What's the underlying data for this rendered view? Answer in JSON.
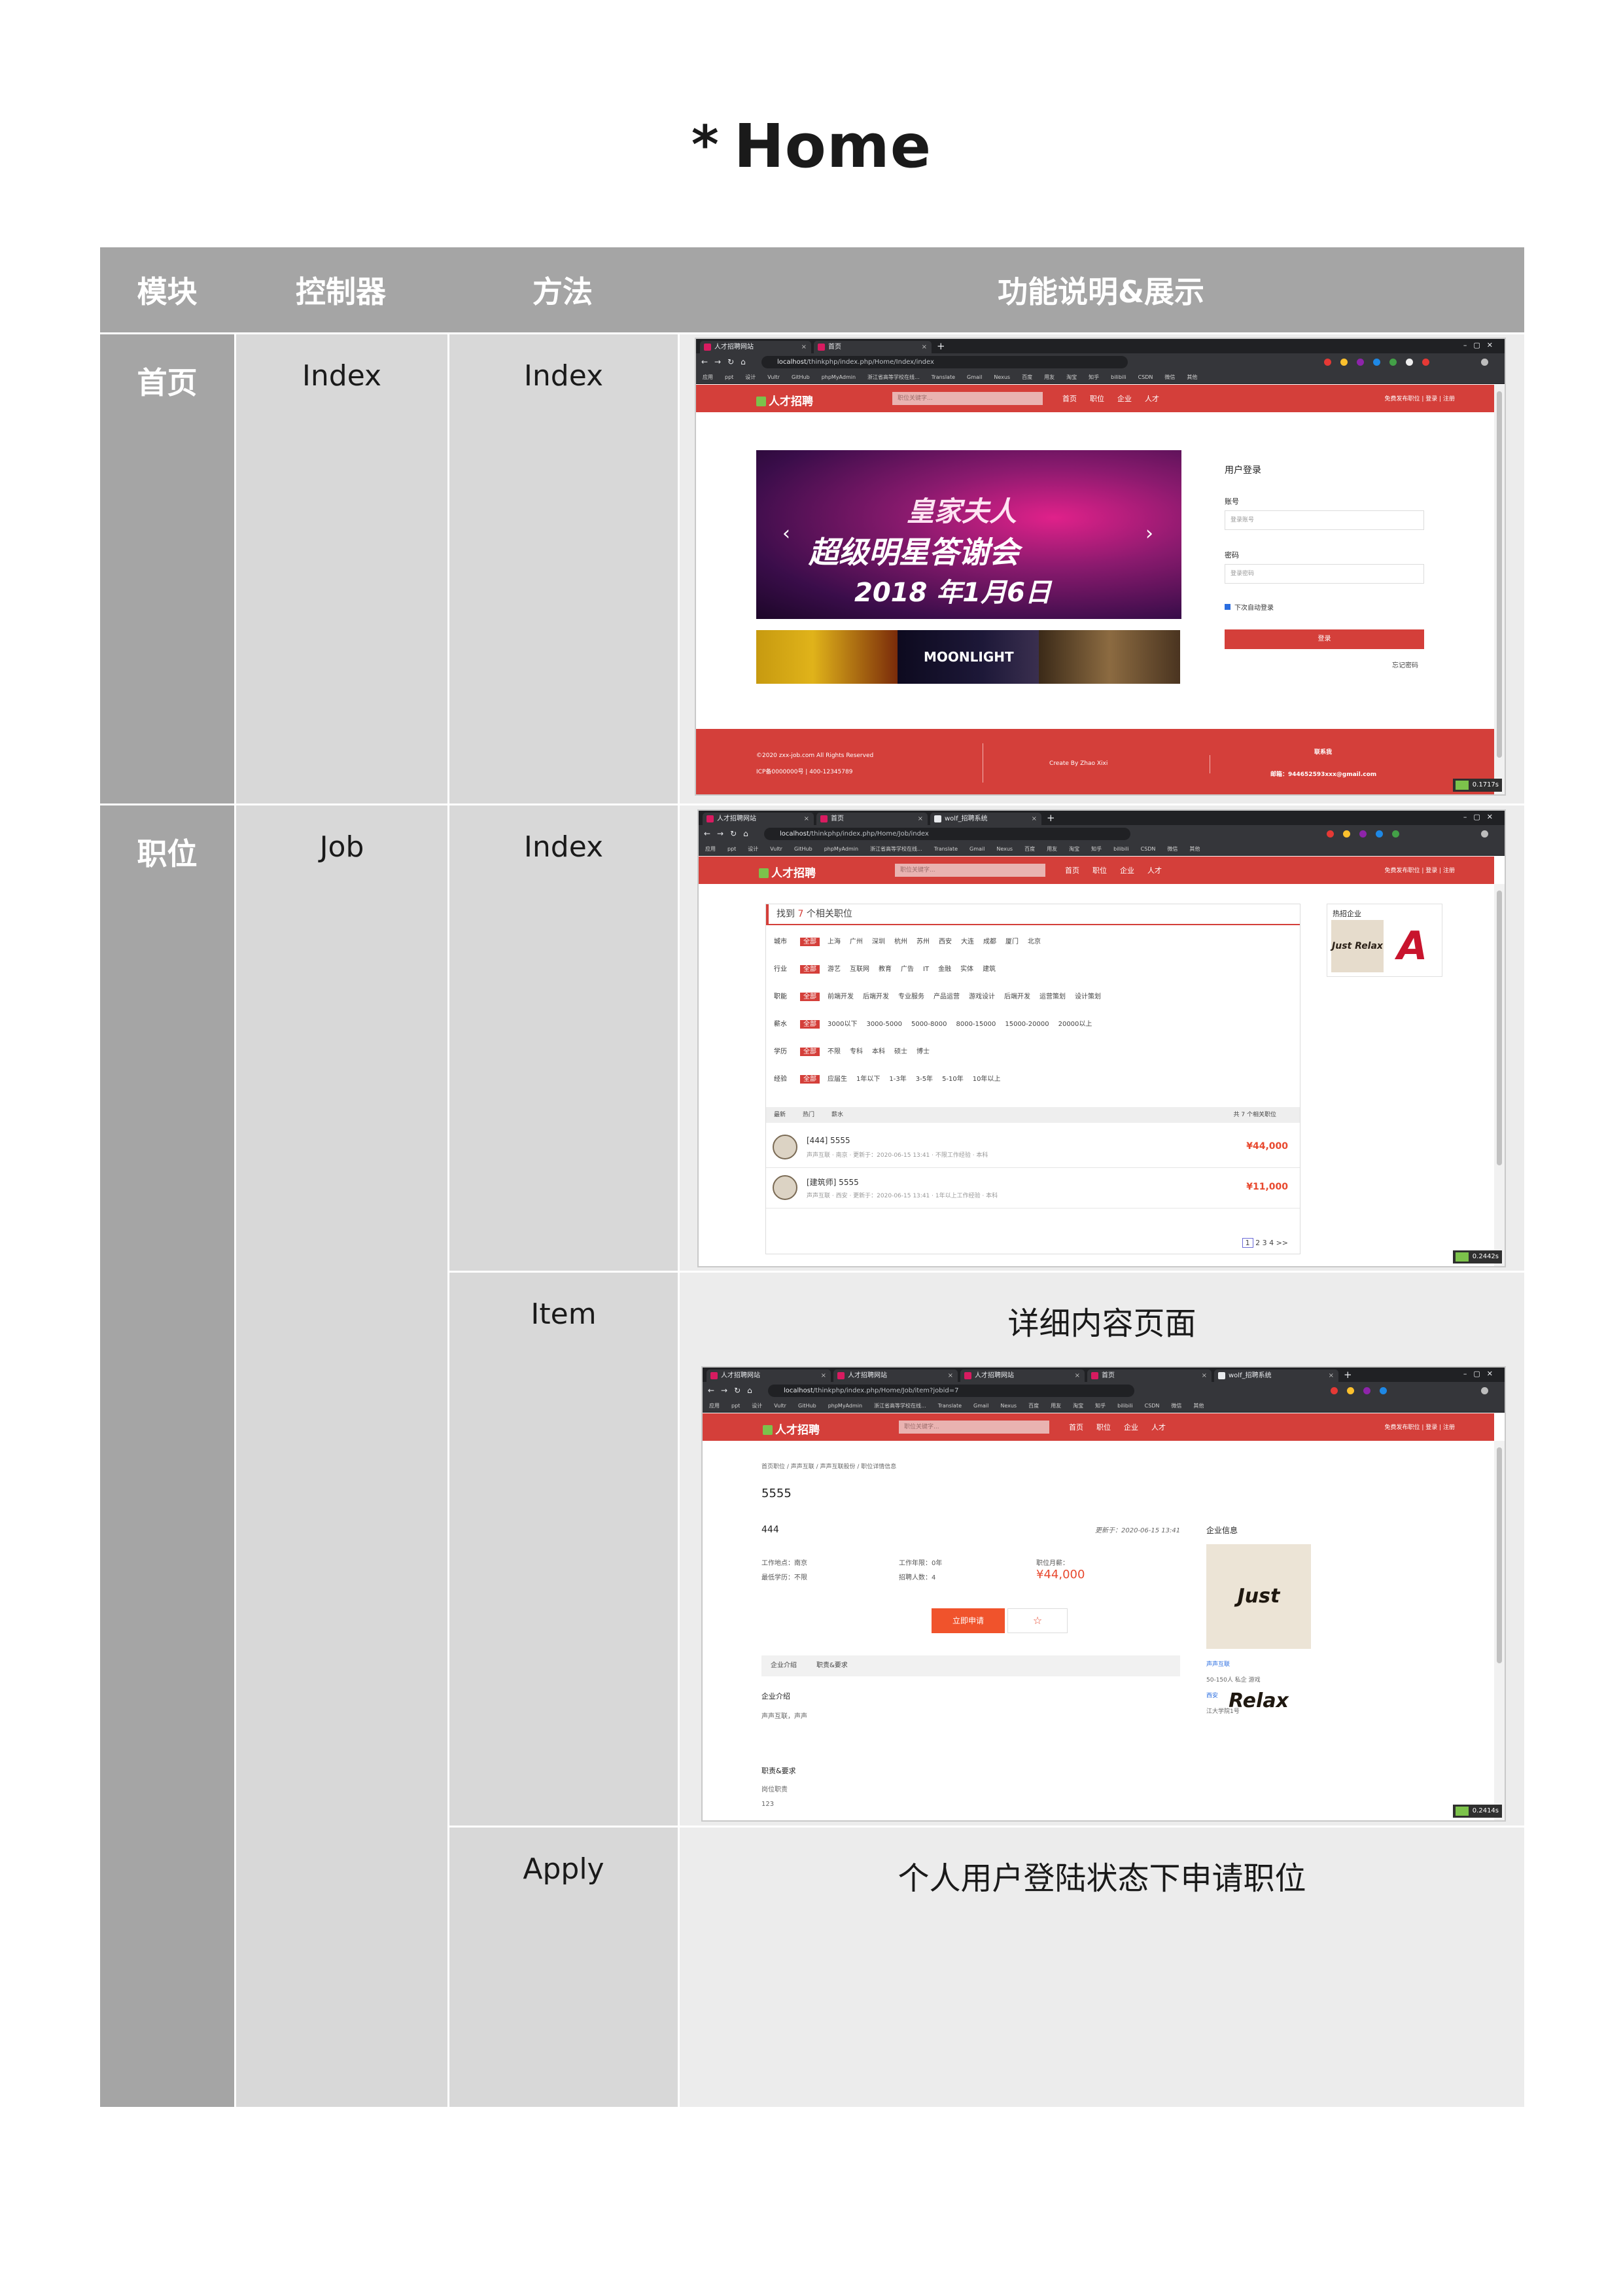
{
  "title": {
    "bullet": "*",
    "text": "Home"
  },
  "table": {
    "headers": [
      "模块",
      "控制器",
      "方法",
      "功能说明&展示"
    ],
    "rows": [
      {
        "module": "首页",
        "controller": "Index",
        "method": "Index"
      },
      {
        "module": "职位",
        "controller": "Job",
        "method": "Index"
      },
      {
        "method": "Item",
        "description": "详细内容页面"
      },
      {
        "method": "Apply",
        "description": "个人用户登陆状态下申请职位"
      }
    ]
  },
  "browser": {
    "tabs_home": [
      "人才招聘网站",
      "首页"
    ],
    "tabs_job": [
      "人才招聘网站",
      "首页",
      "wolf_招聘系统"
    ],
    "tabs_item": [
      "人才招聘网站",
      "人才招聘网站",
      "人才招聘网站",
      "首页",
      "wolf_招聘系统"
    ],
    "new_tab": "+",
    "url_home": {
      "host": "localhost",
      "path": "/thinkphp/index.php/Home/Index/index"
    },
    "url_job": {
      "host": "localhost",
      "path": "/thinkphp/index.php/Home/Job/index"
    },
    "url_item": {
      "host": "localhost",
      "path": "/thinkphp/index.php/Home/Job/item?jobid=7"
    },
    "bookmarks": [
      "应用",
      "ppt",
      "设计",
      "Vultr",
      "GitHub",
      "phpMyAdmin",
      "浙江省高等学校在线...",
      "Translate",
      "Gmail",
      "Nexus",
      "百度",
      "用友",
      "淘宝",
      "知乎",
      "bilibili",
      "CSDN",
      "微信",
      "其他"
    ]
  },
  "site": {
    "logo": "人才招聘",
    "search_placeholder": "职位关键字...",
    "nav": [
      "首页",
      "职位",
      "企业",
      "人才"
    ],
    "top_links": "免费发布职位  |  登录  |  注册"
  },
  "home": {
    "banner_line1": "皇家夫人",
    "banner_line2": "超级明星答谢会",
    "banner_line3": "2018 年1月6日",
    "thumb_text": "MOONLIGHT",
    "login_title": "用户登录",
    "account_label": "账号",
    "account_placeholder": "登录账号",
    "password_label": "密码",
    "password_placeholder": "登录密码",
    "remember": "下次自动登录",
    "login_button": "登录",
    "forgot": "忘记密码",
    "footer_copyright": "©2020 zxx-job.com All Rights Reserved",
    "footer_icp": "ICP备0000000号 | 400-12345789",
    "footer_credit": "Create By Zhao Xixi",
    "footer_contact_title": "联系我",
    "footer_contact": "邮箱：944652593xxx@gmail.com",
    "timer": "0.1717s"
  },
  "job": {
    "found_prefix": "找到",
    "found_count": "7",
    "found_suffix": "个相关职位",
    "filters": [
      {
        "key": "城市",
        "active": "全部",
        "options": [
          "上海",
          "广州",
          "深圳",
          "杭州",
          "苏州",
          "西安",
          "大连",
          "成都",
          "厦门",
          "北京"
        ]
      },
      {
        "key": "行业",
        "active": "全部",
        "options": [
          "游艺",
          "互联网",
          "教育",
          "广告",
          "IT",
          "金融",
          "实体",
          "建筑"
        ]
      },
      {
        "key": "职能",
        "active": "全部",
        "options": [
          "前端开发",
          "后端开发",
          "专业服务",
          "产品运营",
          "游戏设计",
          "后端开发",
          "运营策划",
          "设计策划"
        ]
      },
      {
        "key": "薪水",
        "active": "全部",
        "options": [
          "3000以下",
          "3000-5000",
          "5000-8000",
          "8000-15000",
          "15000-20000",
          "20000以上"
        ]
      },
      {
        "key": "学历",
        "active": "全部",
        "options": [
          "不限",
          "专科",
          "本科",
          "硕士",
          "博士"
        ]
      },
      {
        "key": "经验",
        "active": "全部",
        "options": [
          "应届生",
          "1年以下",
          "1-3年",
          "3-5年",
          "5-10年",
          "10年以上"
        ]
      }
    ],
    "sort": [
      "最新",
      "热门",
      "薪水"
    ],
    "sort_count": "共 7 个相关职位",
    "listings": [
      {
        "title": "[444] 5555",
        "meta": "声声互联  ·  南京  ·  更新于：2020-06-15 13:41  ·  不限工作经验  ·  本科",
        "salary": "¥44,000"
      },
      {
        "title": "[建筑师] 5555",
        "meta": "声声互联  ·  西安  ·  更新于：2020-06-15 13:41  ·  1年以上工作经验  ·  本科",
        "salary": "¥11,000"
      }
    ],
    "pages": [
      "1",
      "2",
      "3",
      "4",
      ">>"
    ],
    "hot_title": "热招企业",
    "logo_a": "Just Relax",
    "logo_b": "A",
    "timer": "0.2442s"
  },
  "item": {
    "breadcrumb": "首页职位 / 声声互联 / 声声互联股份 / 职位详情信息",
    "title": "5555",
    "subtitle": "444",
    "updated": "更新于：2020-06-15 13:41",
    "place": "工作地点：南京",
    "education": "最低学历：不限",
    "experience": "工作年限：0年",
    "headcount": "招聘人数：4",
    "salary_label": "职位月薪：",
    "salary": "¥44,000",
    "apply_button": "立即申请",
    "fav_button": "☆",
    "tabs": [
      "企业介绍",
      "职责&要求"
    ],
    "intro_title": "企业介绍",
    "intro_text": "声声互联，声声",
    "req_title": "职责&要求",
    "req_text": "岗位职责",
    "req_text2": "123",
    "company_title": "企业信息",
    "company_logo": "Just Relax",
    "company_name": "声声互联",
    "company_size": "50-150人  私企  游戏",
    "company_city": "西安",
    "company_addr": "江大学院1号",
    "timer": "0.2414s"
  }
}
